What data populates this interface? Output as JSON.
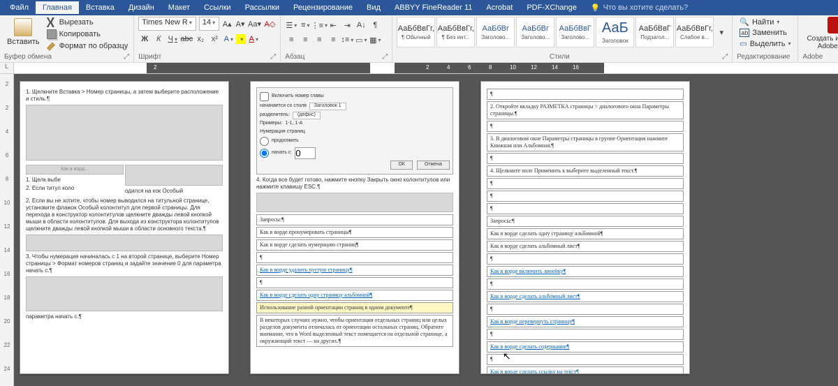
{
  "tabs": {
    "file": "Файл",
    "home": "Главная",
    "insert": "Вставка",
    "design": "Дизайн",
    "layout": "Макет",
    "references": "Ссылки",
    "mailings": "Рассылки",
    "review": "Рецензирование",
    "view": "Вид",
    "abbyy": "ABBYY FineReader 11",
    "acrobat": "Acrobat",
    "pdfx": "PDF-XChange",
    "tellme": "Что вы хотите сделать?"
  },
  "clipboard": {
    "paste": "Вставить",
    "cut": "Вырезать",
    "copy": "Копировать",
    "format_painter": "Формат по образцу",
    "group": "Буфер обмена"
  },
  "font": {
    "name": "Times New R",
    "size": "14",
    "group": "Шрифт",
    "bold": "Ж",
    "italic": "К",
    "underline": "Ч",
    "strike": "abc",
    "sub": "x₂",
    "sup": "x²"
  },
  "para": {
    "group": "Абзац"
  },
  "styles": {
    "group": "Стили",
    "items": [
      {
        "sample": "АаБбВвГг,",
        "cap": "¶ Обычный"
      },
      {
        "sample": "АаБбВвГг,",
        "cap": "¶ Без инт..."
      },
      {
        "sample": "АаБбВг",
        "cap": "Заголово..."
      },
      {
        "sample": "АаБбВг",
        "cap": "Заголово..."
      },
      {
        "sample": "АаБбВвГ",
        "cap": "Заголово..."
      },
      {
        "sample": "АаБ",
        "cap": "Заголовок"
      },
      {
        "sample": "АаБбВвГ",
        "cap": "Подзагол..."
      },
      {
        "sample": "АаБбВвГг,",
        "cap": "Слабое в..."
      }
    ]
  },
  "editing": {
    "find": "Найти",
    "replace": "Заменить",
    "select": "Выделить",
    "group": "Редактирование"
  },
  "adobe": {
    "create": "Создать и подели",
    "pdf": "Adobe PDF",
    "group": "Adobe"
  },
  "ruler": {
    "corner": "L",
    "marks": [
      "2",
      "",
      "2",
      "4",
      "6",
      "8",
      "10",
      "12",
      "14",
      "16"
    ]
  },
  "gutter_marks": [
    "2",
    "2",
    "4",
    "6",
    "8",
    "10",
    "12",
    "14",
    "16",
    "18",
    "20",
    "22",
    "24"
  ],
  "page1": {
    "t1": "1. Щелкните Вставка > Номер страницы, а затем выберите расположение и стиль.¶",
    "mid1": "Как в ворд...",
    "l1": "1. Щелк выбе",
    "l2": "2. Если титул коло",
    "l3": "одился на кок Особый",
    "t2": "2. Если вы не хотите, чтобы номер выводился на титульной странице, установите флажок Особый колонтитул для первой страницы. Для перехода в конструктор колонтитулов щелкните дважды левой кнопкой мыши в области колонтитулов. Для выхода из конструктора колонтитулов щелкните дважды левой кнопкой мыши в области основного текста.¶",
    "t3": "3. Чтобы нумерация начиналась с 1 на второй странице, выберите Номер страницы > Формат номеров страниц и задайте значение 0 для параметра начать с.¶",
    "t4": "параметра начать с.¶"
  },
  "page2": {
    "dlg_chk": "Включить номер главы",
    "dlg_l1": "начинается со стиля",
    "dlg_v1": "Заголовок 1",
    "dlg_l2": "разделитель:",
    "dlg_v2": "(дефис)",
    "dlg_l3": "Примеры:",
    "dlg_v3": "1-1, 1-A",
    "dlg_grp": "Нумерация страниц",
    "dlg_r1": "продолжить",
    "dlg_r2": "начать с:",
    "dlg_start": "0",
    "dlg_ok": "ОК",
    "dlg_cancel": "Отмена",
    "t1": "4. Когда все будет готово, нажмите кнопку Закрыть окно колонтитулов или нажмите клавишу ESC.¶",
    "q": "Запросы:¶",
    "q1": "Как в ворде пронумеровать страницы¶",
    "q2": "Как в ворде сделать нумерацию страниц¶",
    "l1": "Как в ворде удалить пустую страницу¶",
    "l2": "Как в ворде сделать одну страницу альбомной¶",
    "h": "Использование разной ориентации страниц в одном документе¶",
    "t2": "В некоторых случаях нужно, чтобы ориентация отдельных страниц или целых разделов документа отличалась от ориентации остальных страниц. Обратите внимание, что в Word выделенный текст помещается на отдельной странице, а окружающий текст — на других.¶"
  },
  "page3": {
    "c1": "2. Откройте вкладку РАЗМЕТКА страницы > диалогового окна Параметры страницы.¶",
    "c2": "3. В диалоговом окне Параметры страницы в группе Ориентация нажмите Книжная или Альбомная.¶",
    "c3": "4. Щелкните поле Применить к выберите выделенный текст.¶",
    "q": "Запросы:¶",
    "q1": "Как в ворде сделать одну страницу альбомной¶",
    "q2": "Как в ворде сделать альбомный лист¶",
    "l1": "Как в ворде включить линейку¶",
    "l2": "Как в ворде сделать альбомный лист¶",
    "l3": "Как в ворде перевернуть страницу¶",
    "l4": "Как в ворде сделать содержание¶",
    "l5": "Как в ворде сделать ссылку на текст¶"
  }
}
